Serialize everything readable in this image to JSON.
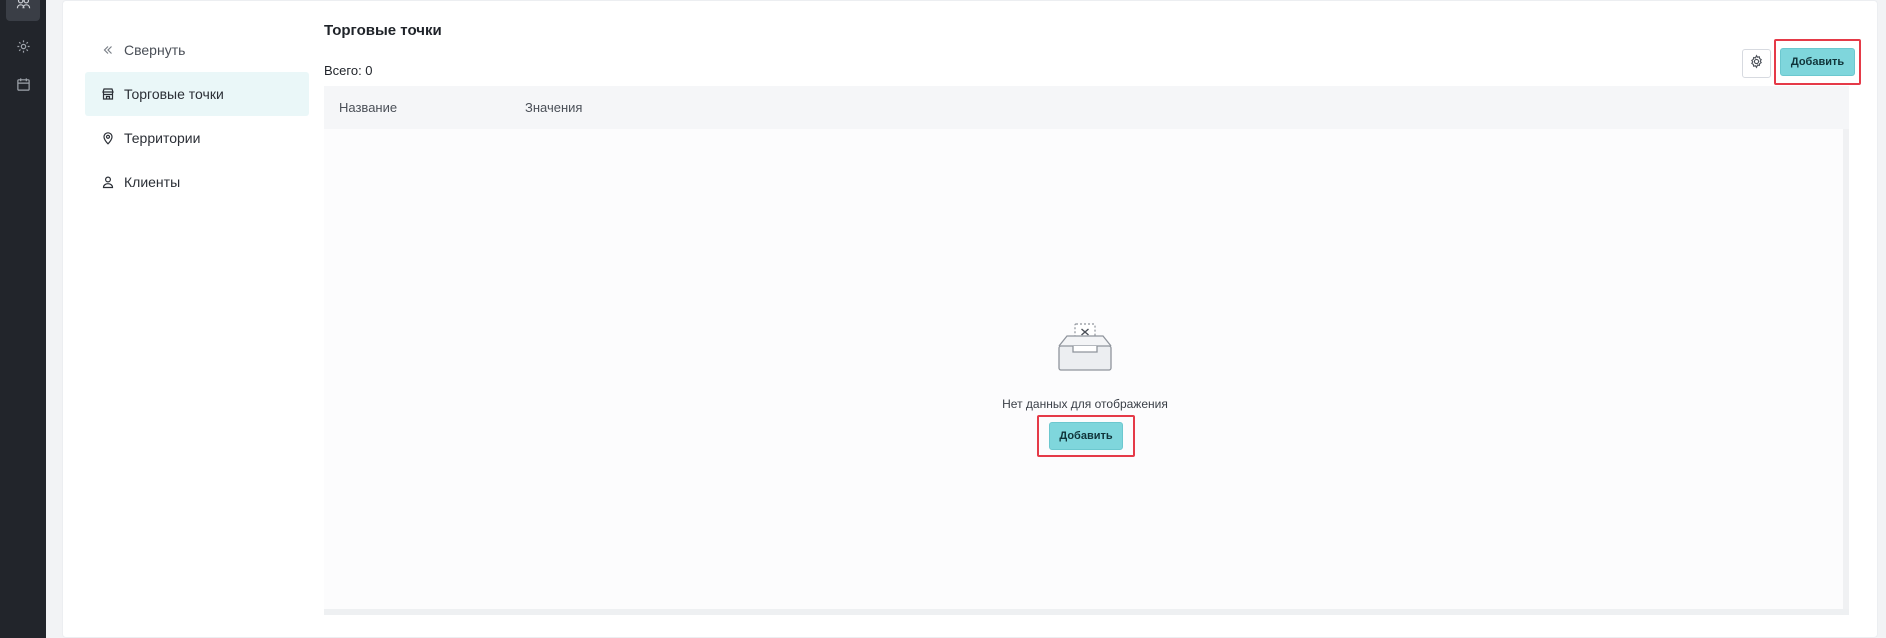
{
  "rail": {
    "items": [
      {
        "icon": "users-icon",
        "active": true
      },
      {
        "icon": "gear-icon",
        "active": false
      },
      {
        "icon": "calendar-icon",
        "active": false
      }
    ]
  },
  "sidebar": {
    "collapse_label": "Свернуть",
    "items": [
      {
        "label": "Торговые точки",
        "icon": "store-icon",
        "active": true
      },
      {
        "label": "Территории",
        "icon": "location-pin-icon",
        "active": false
      },
      {
        "label": "Клиенты",
        "icon": "user-icon",
        "active": false
      }
    ]
  },
  "main": {
    "title": "Торговые точки",
    "total_label": "Всего: 0",
    "add_button_label": "Добавить",
    "table": {
      "columns": [
        "Название",
        "Значения"
      ]
    },
    "empty_state": {
      "icon": "empty-box-icon",
      "message": "Нет данных для отображения",
      "button_label": "Добавить"
    }
  },
  "colors": {
    "accent": "#7fd6dc",
    "highlight_border": "#e53a48",
    "rail_background": "#22252b"
  }
}
